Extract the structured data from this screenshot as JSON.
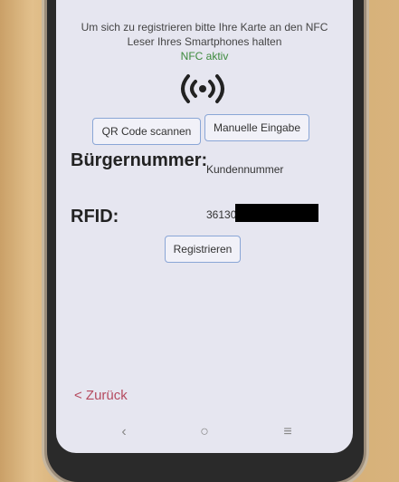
{
  "nfc": {
    "hint": "Um sich zu registrieren bitte Ihre Karte an den NFC Leser Ihres Smartphones halten",
    "status": "NFC aktiv"
  },
  "buttons": {
    "qr_scan": "QR Code scannen",
    "manual_input": "Manuelle Eingabe",
    "register": "Registrieren"
  },
  "fields": {
    "burger_label": "Bürgernummer:",
    "burger_value": "Kundennummer",
    "rfid_label": "RFID:",
    "rfid_value": "36130"
  },
  "footer": {
    "back_label": "< Zurück"
  },
  "navigation": {
    "back_symbol": "‹",
    "home_symbol": "○",
    "menu_symbol": "≡"
  },
  "colors": {
    "screen_bg": "#e6e6f0",
    "button_border": "#8aa6d6",
    "nfc_status": "#3d8a3d",
    "back_link": "#b54a5f"
  }
}
